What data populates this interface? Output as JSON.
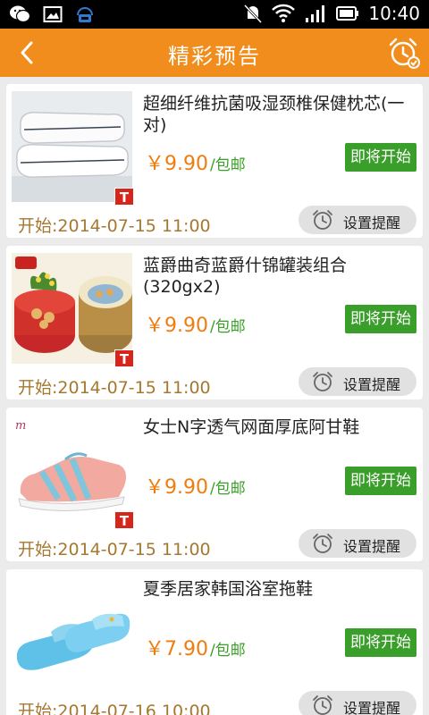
{
  "status_bar": {
    "time": "10:40",
    "left_icons": [
      "wechat-icon",
      "gallery-icon",
      "robot-icon"
    ],
    "right_icons": [
      "mute-icon",
      "wifi-icon",
      "signal-icon",
      "battery-icon"
    ]
  },
  "header": {
    "title": "精彩预告",
    "back_icon": "chevron-left-icon",
    "right_icon": "alarm-clock-icon"
  },
  "colors": {
    "header": "#f08d1c",
    "price": "#f07c0e",
    "shipping": "#3aa028",
    "soon_button": "#3a9e2a",
    "start_time": "#a6782f",
    "badge": "#d8251c"
  },
  "products": [
    {
      "name": "超细纤维抗菌吸湿颈椎保健枕芯(一对)",
      "price": "￥9.90",
      "shipping": "/包邮",
      "status_button": "即将开始",
      "start_time": "开始:2014-07-15 11:00",
      "remind_button": "设置提醒",
      "badge": "T",
      "image": "pillow"
    },
    {
      "name": "蓝爵曲奇蓝爵什锦罐装组合(320gx2)",
      "price": "￥9.90",
      "shipping": "/包邮",
      "status_button": "即将开始",
      "start_time": "开始:2014-07-15 11:00",
      "remind_button": "设置提醒",
      "badge": "T",
      "image": "cookie-tins"
    },
    {
      "name": "女士N字透气网面厚底阿甘鞋",
      "price": "￥9.90",
      "shipping": "/包邮",
      "status_button": "即将开始",
      "start_time": "开始:2014-07-15 11:00",
      "remind_button": "设置提醒",
      "badge": "T",
      "image": "sneaker"
    },
    {
      "name": "夏季居家韩国浴室拖鞋",
      "price": "￥7.90",
      "shipping": "/包邮",
      "status_button": "即将开始",
      "start_time": "开始:2014-07-16 10:00",
      "remind_button": "设置提醒",
      "badge": "",
      "image": "slippers"
    }
  ]
}
